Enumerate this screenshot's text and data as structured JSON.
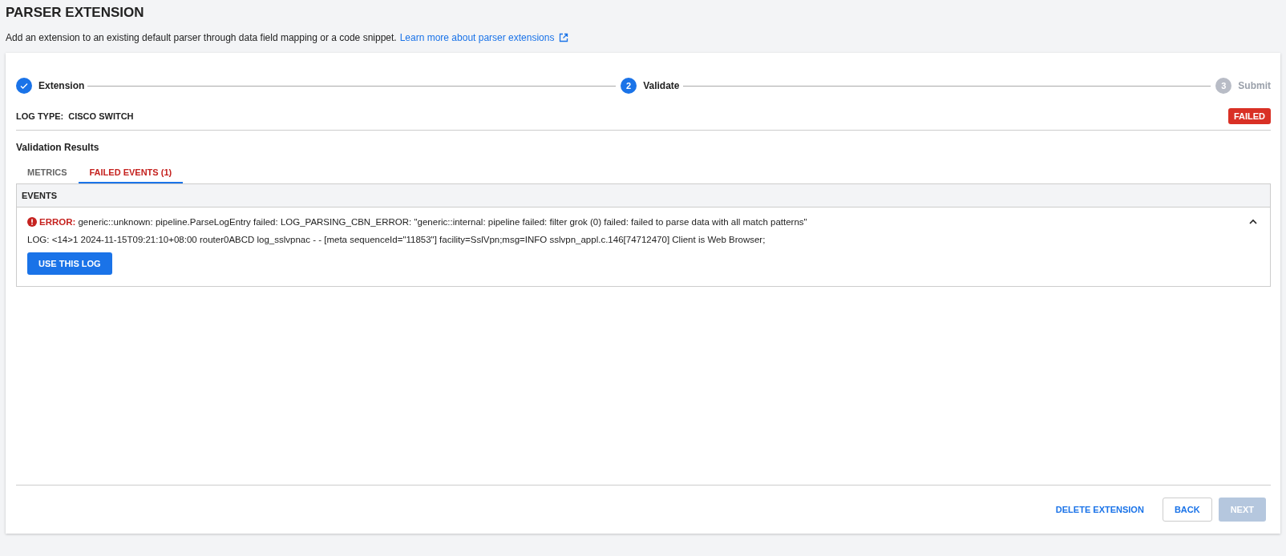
{
  "page": {
    "title": "PARSER EXTENSION",
    "description": "Add an extension to an existing default parser through data field mapping or a code snippet.",
    "learn_more_link": "Learn more about parser extensions"
  },
  "steps": [
    {
      "label": "Extension",
      "completed": true,
      "reached": true
    },
    {
      "number": "2",
      "label": "Validate",
      "completed": false,
      "reached": true
    },
    {
      "number": "3",
      "label": "Submit",
      "completed": false,
      "reached": false
    }
  ],
  "log_type": {
    "label": "LOG TYPE:",
    "value": "CISCO SWITCH",
    "status_badge": "FAILED"
  },
  "validation_results": {
    "heading": "Validation Results",
    "tabs": [
      {
        "label": "METRICS",
        "selected": false
      },
      {
        "label": "FAILED EVENTS (1)",
        "selected": true
      }
    ],
    "events_header": "EVENTS",
    "events": [
      {
        "error_label": "ERROR:",
        "error_message": "generic::unknown: pipeline.ParseLogEntry failed: LOG_PARSING_CBN_ERROR: \"generic::internal: pipeline failed: filter grok (0) failed: failed to parse data with all match patterns\"",
        "expanded": true,
        "log": "LOG: <14>1 2024-11-15T09:21:10+08:00 router0ABCD log_sslvpnac - - [meta sequenceId=\"11853\"] facility=SslVpn;msg=INFO sslvpn_appl.c.146[74712470] Client is Web Browser;",
        "action": "USE THIS LOG"
      }
    ]
  },
  "footer_buttons": [
    {
      "label": "DELETE EXTENSION",
      "kind": "text",
      "disabled": false
    },
    {
      "label": "BACK",
      "kind": "outlined",
      "disabled": false
    },
    {
      "label": "NEXT",
      "kind": "filled",
      "disabled": true
    }
  ]
}
